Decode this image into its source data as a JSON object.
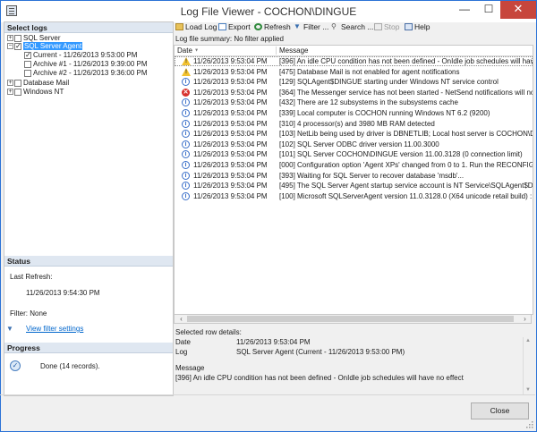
{
  "window": {
    "title": "Log File Viewer - COCHON\\DINGUE",
    "minimize": "—",
    "maximize": "☐",
    "close": "✕"
  },
  "left_panel": {
    "select_logs_header": "Select logs",
    "tree": [
      {
        "label": "SQL Server",
        "expander": "+",
        "checked": false
      },
      {
        "label": "SQL Server Agent",
        "expander": "−",
        "checked": true,
        "selected": true
      },
      {
        "label": "Current - 11/26/2013 9:53:00 PM",
        "checked": true
      },
      {
        "label": "Archive #1 - 11/26/2013 9:39:00 PM",
        "checked": false
      },
      {
        "label": "Archive #2 - 11/26/2013 9:36:00 PM",
        "checked": false
      },
      {
        "label": "Database Mail",
        "expander": "+",
        "checked": false
      },
      {
        "label": "Windows NT",
        "expander": "+",
        "checked": false
      }
    ],
    "status_header": "Status",
    "last_refresh_label": "Last Refresh:",
    "last_refresh_value": "11/26/2013 9:54:30 PM",
    "filter_label": "Filter: None",
    "view_filter_link": "View filter settings",
    "progress_header": "Progress",
    "progress_text": "Done (14 records)."
  },
  "toolbar": {
    "load_log": "Load Log",
    "export": "Export",
    "refresh": "Refresh",
    "filter": "Filter ...",
    "search": "Search ...",
    "stop": "Stop",
    "help": "Help"
  },
  "summary": "Log file summary: No filter applied",
  "grid": {
    "col_date": "Date",
    "col_message": "Message",
    "sort_icon": "▼",
    "rows": [
      {
        "type": "warning",
        "date": "11/26/2013 9:53:04 PM",
        "message": "[396] An idle CPU condition has not been defined - OnIdle job schedules will have no"
      },
      {
        "type": "warning",
        "date": "11/26/2013 9:53:04 PM",
        "message": "[475] Database Mail is not enabled for agent notifications"
      },
      {
        "type": "info",
        "date": "11/26/2013 9:53:04 PM",
        "message": "[129] SQLAgent$DINGUE starting under Windows NT service control"
      },
      {
        "type": "error",
        "date": "11/26/2013 9:53:04 PM",
        "message": "[364] The Messenger service has not been started - NetSend notifications will not be"
      },
      {
        "type": "info",
        "date": "11/26/2013 9:53:04 PM",
        "message": "[432] There are 12 subsystems in the subsystems cache"
      },
      {
        "type": "info",
        "date": "11/26/2013 9:53:04 PM",
        "message": "[339] Local computer is COCHON running Windows NT 6.2 (9200)"
      },
      {
        "type": "info",
        "date": "11/26/2013 9:53:04 PM",
        "message": "[310] 4 processor(s) and 3980 MB RAM detected"
      },
      {
        "type": "info",
        "date": "11/26/2013 9:53:04 PM",
        "message": "[103] NetLib being used by driver is DBNETLIB; Local host server is COCHON\\DINGUE"
      },
      {
        "type": "info",
        "date": "11/26/2013 9:53:04 PM",
        "message": "[102] SQL Server ODBC driver version 11.00.3000"
      },
      {
        "type": "info",
        "date": "11/26/2013 9:53:04 PM",
        "message": "[101] SQL Server COCHON\\DINGUE version 11.00.3128 (0 connection limit)"
      },
      {
        "type": "info",
        "date": "11/26/2013 9:53:04 PM",
        "message": "[000] Configuration option 'Agent XPs' changed from 0 to 1. Run the RECONFIGUR"
      },
      {
        "type": "info",
        "date": "11/26/2013 9:53:04 PM",
        "message": "[393] Waiting for SQL Server to recover database 'msdb'..."
      },
      {
        "type": "info",
        "date": "11/26/2013 9:53:04 PM",
        "message": "[495] The SQL Server Agent startup service account is NT Service\\SQLAgent$DINGU"
      },
      {
        "type": "info",
        "date": "11/26/2013 9:53:04 PM",
        "message": "[100] Microsoft SQLServerAgent version 11.0.3128.0 (X64 unicode retail build) : Proc"
      }
    ]
  },
  "details": {
    "header": "Selected row details:",
    "date_label": "Date",
    "date_value": "11/26/2013 9:53:04 PM",
    "log_label": "Log",
    "log_value": "SQL Server Agent (Current - 11/26/2013 9:53:00 PM)",
    "message_label": "Message",
    "message_value": "[396] An idle CPU condition has not been defined - OnIdle job schedules will have no effect"
  },
  "footer": {
    "close_button": "Close"
  }
}
